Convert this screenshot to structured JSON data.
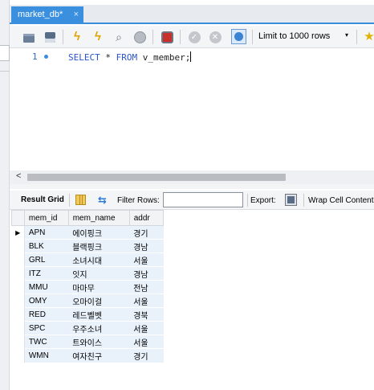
{
  "tab": {
    "title": "market_db*",
    "close": "×"
  },
  "toolbar": {
    "limit_label": "Limit to 1000 rows",
    "limit_arrow": "▾",
    "icons": [
      "open-folder-icon",
      "save-icon",
      "execute-icon",
      "execute-current-icon",
      "explain-icon",
      "stop-icon",
      "stop-on-error-icon",
      "commit-icon",
      "rollback-icon",
      "autocommit-toggle-icon",
      "bookmark-star-icon"
    ]
  },
  "editor": {
    "line_number": "1",
    "sql_keyword_1": "SELECT",
    "sql_star": " * ",
    "sql_keyword_2": "FROM",
    "sql_rest": " v_member;"
  },
  "result_toolbar": {
    "result_grid_label": "Result Grid",
    "filter_rows_label": "Filter Rows:",
    "filter_value": "",
    "export_label": "Export:",
    "wrap_label": "Wrap Cell Content"
  },
  "grid": {
    "columns": [
      "mem_id",
      "mem_name",
      "addr"
    ],
    "current_row_marker": "▶",
    "rows": [
      [
        "APN",
        "에이핑크",
        "경기"
      ],
      [
        "BLK",
        "블랙핑크",
        "경남"
      ],
      [
        "GRL",
        "소녀시대",
        "서울"
      ],
      [
        "ITZ",
        "잇지",
        "경남"
      ],
      [
        "MMU",
        "마마무",
        "전남"
      ],
      [
        "OMY",
        "오마이걸",
        "서울"
      ],
      [
        "RED",
        "레드벨벳",
        "경북"
      ],
      [
        "SPC",
        "우주소녀",
        "서울"
      ],
      [
        "TWC",
        "트와이스",
        "서울"
      ],
      [
        "WMN",
        "여자친구",
        "경기"
      ]
    ]
  },
  "colors": {
    "tab_accent": "#3b8fdf",
    "sql_keyword": "#2a55c7",
    "row_background": "#e9f2fb"
  }
}
